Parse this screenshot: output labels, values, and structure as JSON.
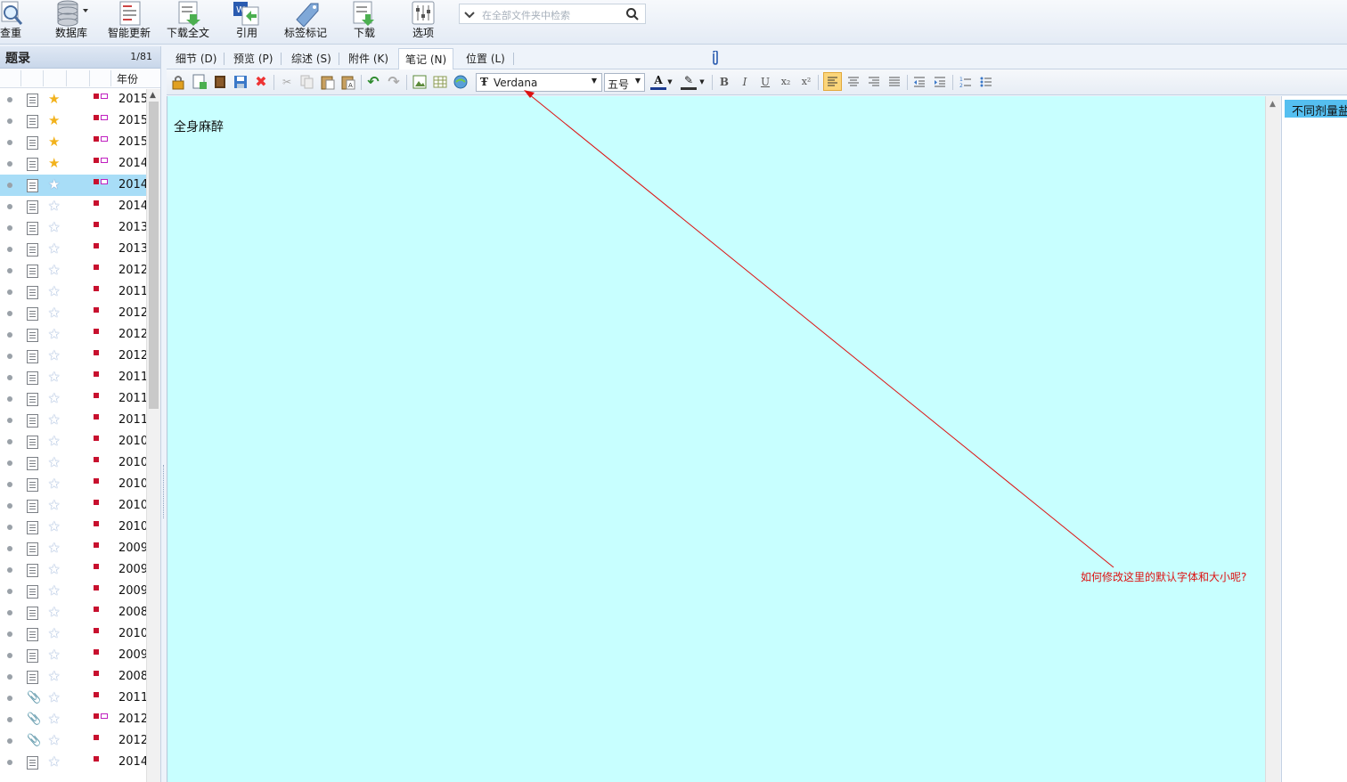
{
  "ribbon": {
    "buttons": [
      {
        "label": "查重",
        "icon": "magnifier-icon"
      },
      {
        "label": "数据库",
        "icon": "database-icon"
      },
      {
        "label": "智能更新",
        "icon": "smart-update-icon"
      },
      {
        "label": "下载全文",
        "icon": "download-fulltext-icon"
      },
      {
        "label": "引用",
        "icon": "cite-icon"
      },
      {
        "label": "标签标记",
        "icon": "tag-icon"
      },
      {
        "label": "下载",
        "icon": "download-icon"
      },
      {
        "label": "选项",
        "icon": "options-icon"
      }
    ],
    "search_placeholder": "在全部文件夹中检索"
  },
  "left_panel": {
    "title": "题录",
    "count": "1/81",
    "column_year": "年份",
    "rows": [
      {
        "year": "2015",
        "starred": true,
        "tags": "rp",
        "pin": false
      },
      {
        "year": "2015",
        "starred": true,
        "tags": "rp",
        "pin": false
      },
      {
        "year": "2015",
        "starred": true,
        "tags": "rp",
        "pin": false
      },
      {
        "year": "2014",
        "starred": true,
        "tags": "rp",
        "pin": false
      },
      {
        "year": "2014",
        "starred": false,
        "tags": "rp",
        "pin": false,
        "selected": true
      },
      {
        "year": "2014",
        "starred": false,
        "tags": "r",
        "pin": false
      },
      {
        "year": "2013",
        "starred": false,
        "tags": "r",
        "pin": false
      },
      {
        "year": "2013",
        "starred": false,
        "tags": "r",
        "pin": false
      },
      {
        "year": "2012",
        "starred": false,
        "tags": "r",
        "pin": false
      },
      {
        "year": "2011",
        "starred": false,
        "tags": "r",
        "pin": false
      },
      {
        "year": "2012",
        "starred": false,
        "tags": "r",
        "pin": false
      },
      {
        "year": "2012",
        "starred": false,
        "tags": "r",
        "pin": false
      },
      {
        "year": "2012",
        "starred": false,
        "tags": "r",
        "pin": false
      },
      {
        "year": "2011",
        "starred": false,
        "tags": "r",
        "pin": false
      },
      {
        "year": "2011",
        "starred": false,
        "tags": "r",
        "pin": false
      },
      {
        "year": "2011",
        "starred": false,
        "tags": "r",
        "pin": false
      },
      {
        "year": "2010",
        "starred": false,
        "tags": "r",
        "pin": false
      },
      {
        "year": "2010",
        "starred": false,
        "tags": "r",
        "pin": false
      },
      {
        "year": "2010",
        "starred": false,
        "tags": "r",
        "pin": false
      },
      {
        "year": "2010",
        "starred": false,
        "tags": "r",
        "pin": false
      },
      {
        "year": "2010",
        "starred": false,
        "tags": "r",
        "pin": false
      },
      {
        "year": "2009",
        "starred": false,
        "tags": "r",
        "pin": false
      },
      {
        "year": "2009",
        "starred": false,
        "tags": "r",
        "pin": false
      },
      {
        "year": "2009",
        "starred": false,
        "tags": "r",
        "pin": false
      },
      {
        "year": "2008",
        "starred": false,
        "tags": "r",
        "pin": false
      },
      {
        "year": "2010",
        "starred": false,
        "tags": "r",
        "pin": false
      },
      {
        "year": "2009",
        "starred": false,
        "tags": "r",
        "pin": false
      },
      {
        "year": "2008",
        "starred": false,
        "tags": "r",
        "pin": false
      },
      {
        "year": "2011",
        "starred": false,
        "tags": "r",
        "pin": true
      },
      {
        "year": "2012",
        "starred": false,
        "tags": "rp",
        "pin": true
      },
      {
        "year": "2012",
        "starred": false,
        "tags": "r",
        "pin": true
      },
      {
        "year": "2014",
        "starred": false,
        "tags": "r",
        "pin": false
      }
    ]
  },
  "tabs": [
    {
      "label": "细节 (D)"
    },
    {
      "label": "预览 (P)"
    },
    {
      "label": "综述 (S)"
    },
    {
      "label": "附件 (K)"
    },
    {
      "label": "笔记 (N)",
      "active": true
    },
    {
      "label": "位置 (L)"
    }
  ],
  "editor_toolbar": {
    "font_name": "Verdana",
    "font_size": "五号",
    "bold": "B",
    "italic": "I",
    "underline": "U"
  },
  "editor": {
    "content": "全身麻醉",
    "background": "#c8ffff"
  },
  "right_pane": {
    "highlight_text": "不同剂量盐"
  },
  "annotation": {
    "text": "如何修改这里的默认字体和大小呢?",
    "color": "#dd1111"
  }
}
